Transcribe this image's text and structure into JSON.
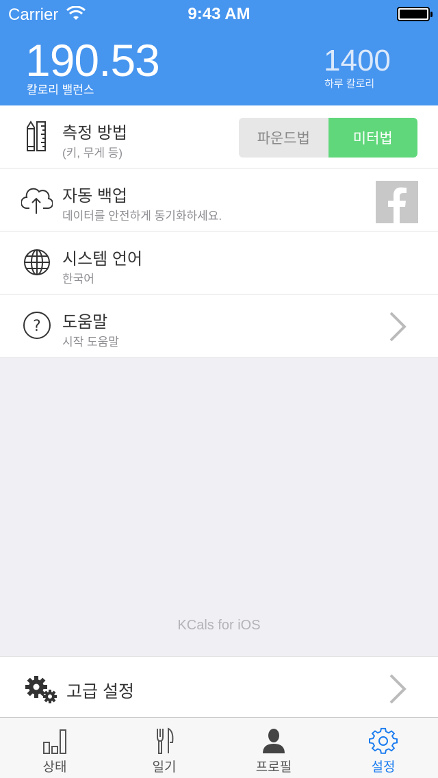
{
  "status_bar": {
    "carrier": "Carrier",
    "time": "9:43 AM"
  },
  "header": {
    "balance_value": "190.53",
    "balance_label": "칼로리 밸런스",
    "daily_value": "1400",
    "daily_label": "하루 칼로리"
  },
  "rows": [
    {
      "title": "측정 방법",
      "subtitle": "(키, 무게 등)",
      "icon": "ruler-pencil-icon",
      "segments": [
        "파운드법",
        "미터법"
      ],
      "selected_segment": "미터법"
    },
    {
      "title": "자동 백업",
      "subtitle": "데이터를 안전하게 동기화하세요.",
      "icon": "cloud-upload-icon",
      "action_icon": "facebook-icon"
    },
    {
      "title": "시스템 언어",
      "subtitle": "한국어",
      "icon": "globe-icon"
    },
    {
      "title": "도움말",
      "subtitle": "시작 도움말",
      "icon": "question-icon"
    }
  ],
  "footer_text": "KCals for iOS",
  "advanced": {
    "label": "고급 설정",
    "icon": "gears-icon"
  },
  "tabbar": {
    "items": [
      {
        "label": "상태",
        "icon": "bar-chart-icon"
      },
      {
        "label": "일기",
        "icon": "fork-knife-icon"
      },
      {
        "label": "프로필",
        "icon": "person-icon"
      },
      {
        "label": "설정",
        "icon": "gear-icon"
      }
    ],
    "active": "설정"
  },
  "colors": {
    "header": "#4695ef",
    "accent_green": "#5fd77a",
    "tab_active": "#1a7cf0"
  }
}
